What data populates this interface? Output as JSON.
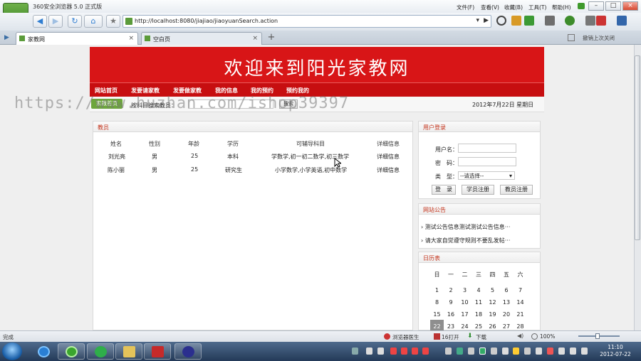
{
  "browser": {
    "title": "360安全浏览器 5.0 正式版",
    "logo_label": "请登录",
    "menu": [
      "文件(F)",
      "查看(V)",
      "收藏(B)",
      "工具(T)",
      "帮助(H)"
    ],
    "window_buttons": [
      "–",
      "□",
      "×"
    ],
    "url": "http://localhost:8080/jiajiao/jiaoyuanSearch.action",
    "tabs": [
      {
        "label": "家教网",
        "close": "×"
      },
      {
        "label": "空白页",
        "close": "×"
      }
    ],
    "new_tab": "+",
    "reopen_label": "撤销上次关闭"
  },
  "page": {
    "banner_title": "欢迎来到阳光家教网",
    "nav": [
      "网站首页",
      "发要请家教",
      "发要做家教",
      "我的信息",
      "我的预约",
      "预约我的"
    ],
    "search": {
      "home_pill": "家教首页",
      "label": "按科目搜索教员：",
      "button": "搜索"
    },
    "date": "2012年7月22日 星期日",
    "watermark": "https://www.huzhan.com/ishop39397",
    "teacher_panel": {
      "title": "教员",
      "columns": [
        "姓名",
        "性别",
        "年龄",
        "学历",
        "可辅导科目",
        "详细信息"
      ],
      "rows": [
        [
          "刘光亮",
          "男",
          "25",
          "本科",
          "学数学,初一初二数学,初三数学",
          "详细信息"
        ],
        [
          "陈小丽",
          "男",
          "25",
          "研究生",
          "小学数学,小学英语,初中数学",
          "详细信息"
        ]
      ]
    },
    "login_panel": {
      "title": "用户登录",
      "username_label": "用户名：",
      "password_label": "密　码：",
      "type_label": "类　型：",
      "type_selected": "--请选择--",
      "buttons": [
        "登　录",
        "学员注册",
        "教员注册"
      ]
    },
    "notice_panel": {
      "title": "网站公告",
      "items": [
        "测试公告信息测试测试公告信息···",
        "请大家自觉遵守规则不要乱发帖···"
      ]
    },
    "calendar_panel": {
      "title": "日历表",
      "weekdays": [
        "日",
        "一",
        "二",
        "三",
        "四",
        "五",
        "六"
      ],
      "weeks": [
        [
          "1",
          "2",
          "3",
          "4",
          "5",
          "6",
          "7"
        ],
        [
          "8",
          "9",
          "10",
          "11",
          "12",
          "13",
          "14"
        ],
        [
          "15",
          "16",
          "17",
          "18",
          "19",
          "20",
          "21"
        ],
        [
          "22",
          "23",
          "24",
          "25",
          "26",
          "27",
          "28"
        ]
      ],
      "today": "22"
    }
  },
  "statusbar": {
    "left": "完成",
    "items": [
      "浏览器医生",
      "16打开",
      "下载",
      "100%"
    ]
  },
  "taskbar": {
    "time": "11:10",
    "date": "2012-07-22"
  },
  "colors": {
    "banner": "#d81517",
    "nav": "#c70e10",
    "panel_title": "#c4341c",
    "home_pill": "#6da63c"
  }
}
